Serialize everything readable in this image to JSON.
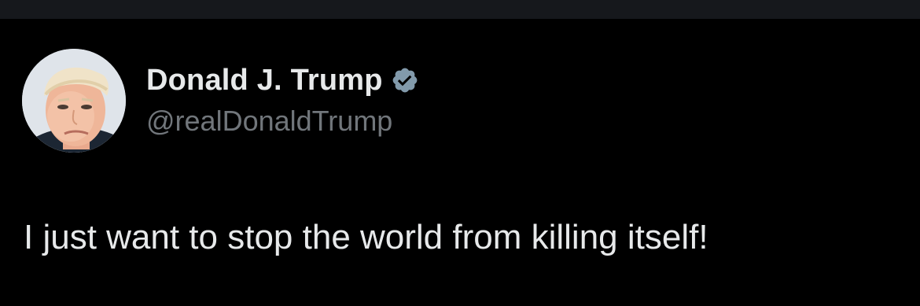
{
  "tweet": {
    "author": {
      "display_name": "Donald J. Trump",
      "handle": "@realDonaldTrump",
      "verified": true,
      "verified_badge_color": "#829aab",
      "avatar_icon": "profile-photo"
    },
    "text": "I just want to stop the world from killing itself!"
  },
  "theme": {
    "background": "#000000",
    "top_bar": "#16181c",
    "primary_text": "#e7e9ea",
    "secondary_text": "#71767b"
  }
}
